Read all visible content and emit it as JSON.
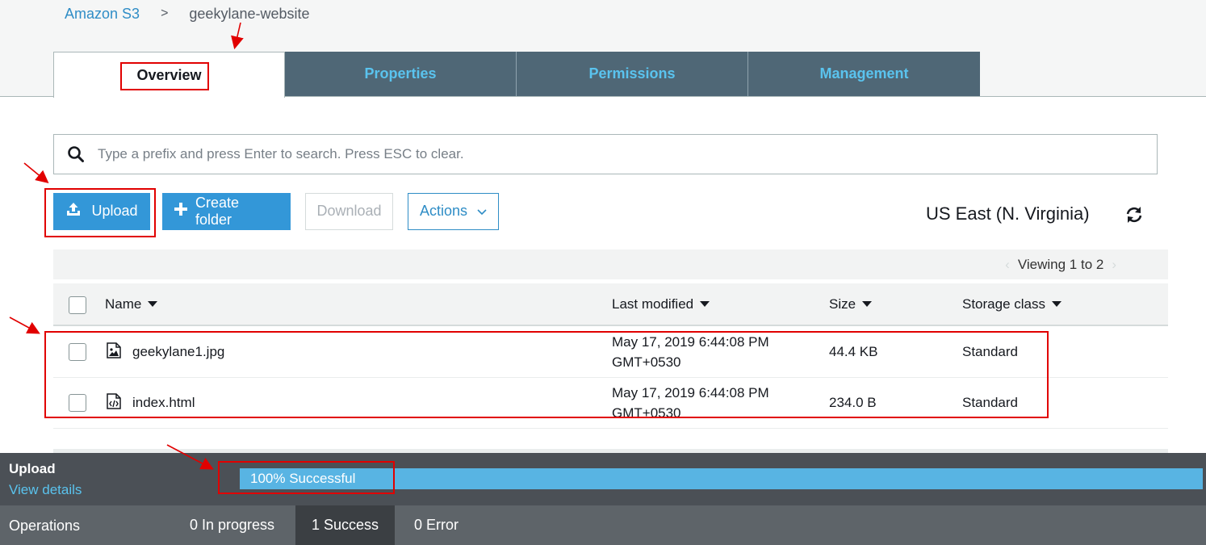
{
  "breadcrumb": {
    "root": "Amazon S3",
    "separator": ">",
    "current": "geekylane-website"
  },
  "tabs": [
    {
      "label": "Overview",
      "active": true
    },
    {
      "label": "Properties",
      "active": false
    },
    {
      "label": "Permissions",
      "active": false
    },
    {
      "label": "Management",
      "active": false
    }
  ],
  "search": {
    "placeholder": "Type a prefix and press Enter to search. Press ESC to clear.",
    "value": ""
  },
  "toolbar": {
    "upload_label": "Upload",
    "create_folder_label": "Create folder",
    "download_label": "Download",
    "actions_label": "Actions"
  },
  "region": "US East (N. Virginia)",
  "pager": {
    "text": "Viewing 1 to 2"
  },
  "table": {
    "columns": [
      "Name",
      "Last modified",
      "Size",
      "Storage class"
    ],
    "rows": [
      {
        "name": "geekylane1.jpg",
        "icon": "image-file-icon",
        "modified_line1": "May 17, 2019 6:44:08 PM",
        "modified_line2": "GMT+0530",
        "size": "44.4 KB",
        "storage_class": "Standard"
      },
      {
        "name": "index.html",
        "icon": "code-file-icon",
        "modified_line1": "May 17, 2019 6:44:08 PM",
        "modified_line2": "GMT+0530",
        "size": "234.0 B",
        "storage_class": "Standard"
      }
    ]
  },
  "upload_panel": {
    "title": "Upload",
    "view_details": "View details",
    "progress_label": "100% Successful",
    "progress_fraction": 1.0
  },
  "operations": {
    "label": "Operations",
    "in_progress": "0 In progress",
    "success": "1 Success",
    "error": "0 Error"
  },
  "colors": {
    "accent": "#3397d8",
    "tab_bg": "#4f6776",
    "tab_text": "#5ac3ee",
    "annotation": "#e10000"
  }
}
